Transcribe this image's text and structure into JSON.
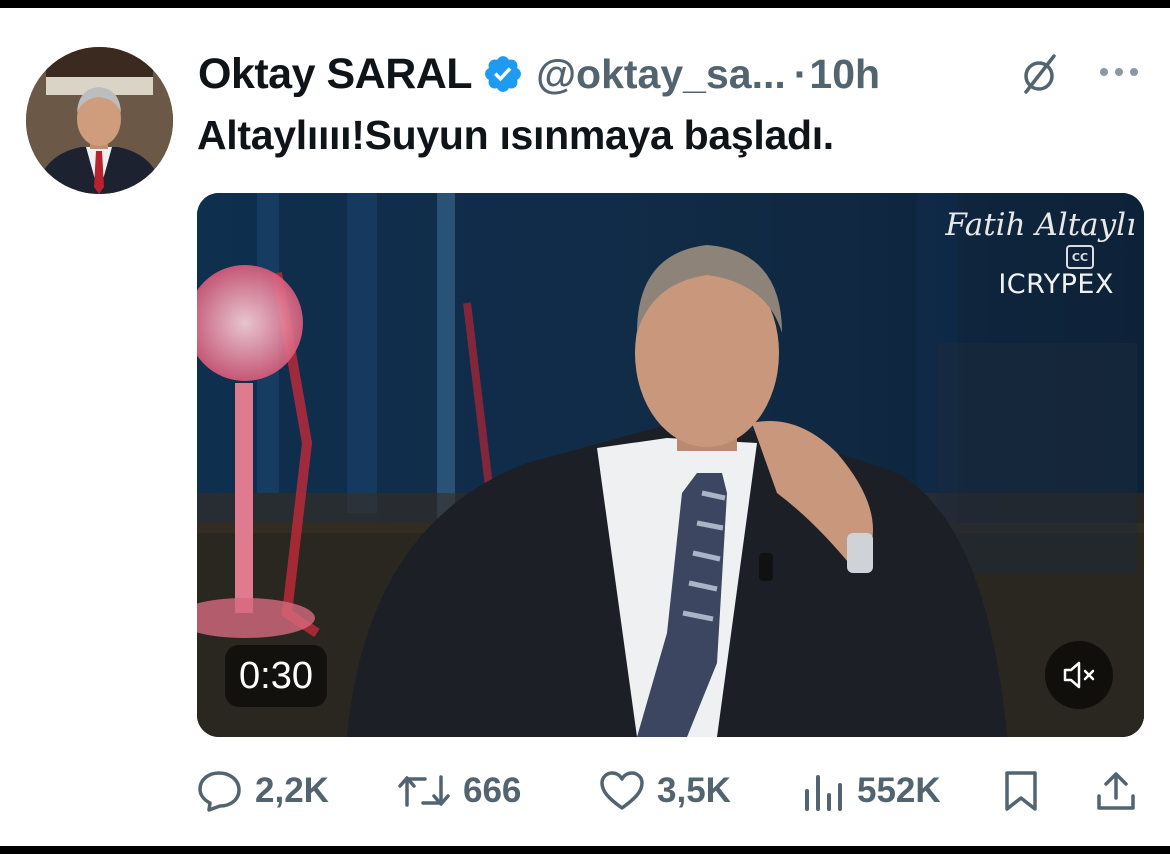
{
  "tweet": {
    "author_name": "Oktay SARAL",
    "handle": "@oktay_sa...",
    "separator": "·",
    "time": "10h",
    "text": "Altaylıııı!Suyun ısınmaya başladı."
  },
  "media": {
    "watermark_name": "Fatih Altaylı",
    "cc_label": "CC",
    "brand": "ICRYPEX",
    "duration": "0:30"
  },
  "actions": {
    "replies": "2,2K",
    "reposts": "666",
    "likes": "3,5K",
    "views": "552K"
  },
  "colors": {
    "verified": "#1d9bf0",
    "secondary_text": "#536471",
    "primary_text": "#0f1419"
  },
  "icons": [
    "verified-badge-icon",
    "grok-icon",
    "more-icon",
    "mute-icon",
    "reply-icon",
    "repost-icon",
    "like-icon",
    "views-icon",
    "bookmark-icon",
    "share-icon"
  ]
}
